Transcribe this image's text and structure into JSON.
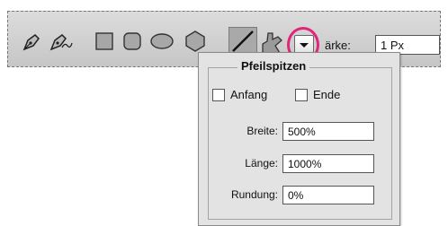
{
  "toolbar": {
    "tools": [
      {
        "name": "pen-tool-icon"
      },
      {
        "name": "freeform-pen-tool-icon"
      },
      {
        "name": "rectangle-tool-icon"
      },
      {
        "name": "rounded-rectangle-tool-icon"
      },
      {
        "name": "ellipse-tool-icon"
      },
      {
        "name": "polygon-tool-icon"
      },
      {
        "name": "line-tool-icon",
        "selected": true
      },
      {
        "name": "custom-shape-tool-icon"
      }
    ],
    "dropdown": {
      "icon": "chevron-down-icon",
      "highlight_color": "#e0267a"
    },
    "staerke_label": "ärke:",
    "staerke_value": "1 Px"
  },
  "arrowheads_panel": {
    "title": "Pfeilspitzen",
    "start_label": "Anfang",
    "start_checked": false,
    "end_label": "Ende",
    "end_checked": false,
    "width_label": "Breite:",
    "width_value": "500%",
    "length_label": "Länge:",
    "length_value": "1000%",
    "concavity_label": "Rundung:",
    "concavity_value": "0%"
  }
}
